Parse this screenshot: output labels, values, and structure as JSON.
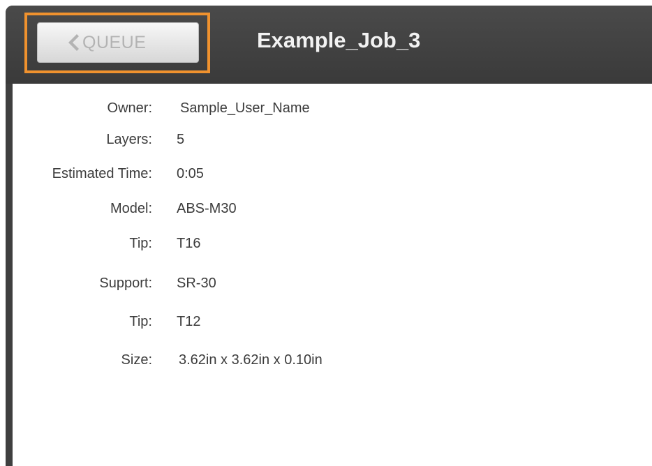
{
  "header": {
    "back_label": "QUEUE",
    "job_title": "Example_Job_3"
  },
  "details": [
    {
      "label": "Owner:",
      "value": "Sample_User_Name"
    },
    {
      "label": "Layers:",
      "value": "5"
    },
    {
      "label": "Estimated Time:",
      "value": "0:05"
    },
    {
      "label": "Model:",
      "value": "ABS-M30"
    },
    {
      "label": "Tip:",
      "value": "T16"
    },
    {
      "label": "Support:",
      "value": "SR-30"
    },
    {
      "label": "Tip:",
      "value": "T12"
    },
    {
      "label": "Size:",
      "value": "3.62in x 3.62in x 0.10in"
    }
  ],
  "colors": {
    "highlight": "#f0922e",
    "header": "#3f3f3f"
  },
  "icons": {
    "back": "chevron-left-icon"
  }
}
